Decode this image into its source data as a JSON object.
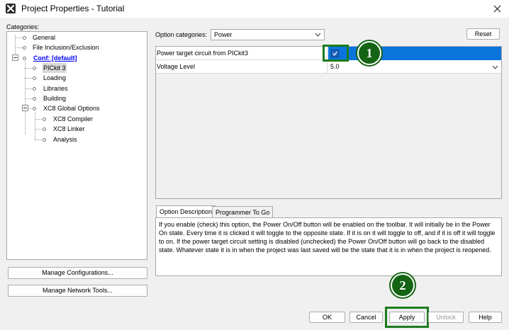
{
  "window": {
    "title": "Project Properties - Tutorial"
  },
  "categories": {
    "label": "Categories:",
    "items": [
      {
        "label": "General"
      },
      {
        "label": "File Inclusion/Exclusion"
      },
      {
        "label": "Conf: [default]"
      },
      {
        "label": "PICkit 3"
      },
      {
        "label": "Loading"
      },
      {
        "label": "Libraries"
      },
      {
        "label": "Building"
      },
      {
        "label": "XC8 Global Options"
      },
      {
        "label": "XC8 Compiler"
      },
      {
        "label": "XC8 Linker"
      },
      {
        "label": "Analysis"
      }
    ],
    "selected": "PICkit 3"
  },
  "left_buttons": {
    "manage_configurations": "Manage Configurations...",
    "manage_network_tools": "Manage Network Tools..."
  },
  "options": {
    "category_label": "Option categories:",
    "category_value": "Power",
    "reset_label": "Reset",
    "rows": [
      {
        "name": "Power target circuit from PICkit3",
        "value": "checked"
      },
      {
        "name": "Voltage Level",
        "value": "5.0"
      }
    ]
  },
  "tabs": [
    {
      "label": "Option Description",
      "active": true
    },
    {
      "label": "Programmer To Go",
      "active": false
    }
  ],
  "description": "If you enable (check) this option, the Power On/Off button will be enabled on the toolbar. It will initially be in the Power On state. Every time it is clicked it will toggle to the opposite state. If it is on it will toggle to off, and if it is off it will toggle to on. If the power target circuit setting is disabled (unchecked) the Power On/Off button will go back to the disabled state. Whatever state it is in when the project was last saved will be the state that it is in when the project is reopened.",
  "footer_buttons": {
    "ok": "OK",
    "cancel": "Cancel",
    "apply": "Apply",
    "unlock": "Unlock",
    "help": "Help"
  },
  "callouts": {
    "one": "1",
    "two": "2"
  },
  "colors": {
    "selection_blue": "#0a74dc",
    "callout_green": "#146414",
    "link_blue": "#0000ee"
  }
}
